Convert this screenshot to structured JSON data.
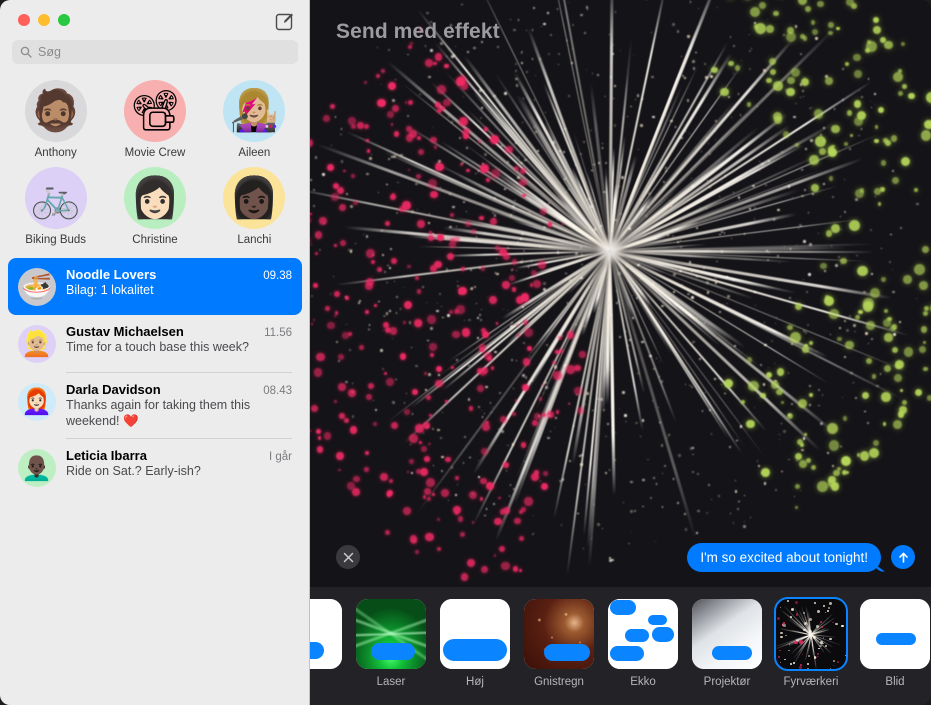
{
  "window": {
    "traffic_lights": [
      "close",
      "minimize",
      "zoom"
    ],
    "compose_label": "compose-message"
  },
  "sidebar": {
    "search": {
      "placeholder": "Søg",
      "value": ""
    },
    "pinned": [
      {
        "name": "Anthony",
        "avatar": "🧔🏽",
        "bg": "#d9d9db"
      },
      {
        "name": "Movie Crew",
        "avatar": "📽",
        "bg": "#f8afaf"
      },
      {
        "name": "Aileen",
        "avatar": "👩🏼‍🎤",
        "bg": "#bfe5f5"
      },
      {
        "name": "Biking Buds",
        "avatar": "🚲",
        "bg": "#ddd0f7"
      },
      {
        "name": "Christine",
        "avatar": "👩🏻",
        "bg": "#b8eec0"
      },
      {
        "name": "Lanchi",
        "avatar": "👩🏿",
        "bg": "#fbe39a"
      }
    ],
    "conversations": [
      {
        "name": "Noodle Lovers",
        "time": "09.38",
        "preview": "Bilag:  1 lokalitet",
        "avatar": "🍜",
        "avatar_bg": "#c9c9cd",
        "selected": true
      },
      {
        "name": "Gustav Michaelsen",
        "time": "11.56",
        "preview": "Time for a touch base this week?",
        "avatar": "👱🏼",
        "avatar_bg": "#dfd0f7",
        "selected": false
      },
      {
        "name": "Darla Davidson",
        "time": "08.43",
        "preview": "Thanks again for taking them this weekend! ❤️",
        "avatar": "👩🏻‍🦰",
        "avatar_bg": "#cfeaf8",
        "selected": false
      },
      {
        "name": "Leticia Ibarra",
        "time": "I går",
        "preview": "Ride on Sat.? Early-ish?",
        "avatar": "👨🏿‍🦲",
        "avatar_bg": "#bdefc3",
        "selected": false
      }
    ]
  },
  "effect_screen": {
    "title": "Send med effekt",
    "close_label": "Luk",
    "send_label": "Send",
    "message_bubble": "I'm so excited about tonight!",
    "effects": [
      {
        "label": "",
        "kind": "white",
        "selected": false,
        "partial": true
      },
      {
        "label": "Laser",
        "kind": "laser",
        "selected": false
      },
      {
        "label": "Høj",
        "kind": "loud",
        "selected": false
      },
      {
        "label": "Gnistregn",
        "kind": "spark",
        "selected": false
      },
      {
        "label": "Ekko",
        "kind": "echo",
        "selected": false
      },
      {
        "label": "Projektør",
        "kind": "projector",
        "selected": false
      },
      {
        "label": "Fyrværkeri",
        "kind": "fireworks",
        "selected": true
      },
      {
        "label": "Blid",
        "kind": "gentle",
        "selected": false
      }
    ]
  },
  "colors": {
    "accent_blue": "#007aff",
    "selected_blue": "#0a84ff",
    "sidebar_bg": "#ececec",
    "effect_bg": "#141317",
    "carousel_bg": "#232327",
    "firework_white": "#fff8ec",
    "firework_pink": "#f02a64",
    "firework_green": "#b5d65a"
  }
}
